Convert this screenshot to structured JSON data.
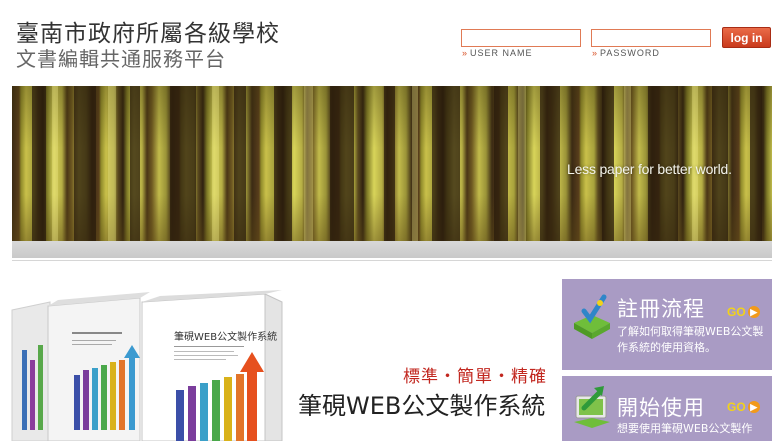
{
  "header": {
    "title": "臺南市政府所屬各級學校",
    "subtitle": "文書編輯共通服務平台"
  },
  "login": {
    "username_value": "",
    "password_value": "",
    "username_label": "USER NAME",
    "password_label": "PASSWORD",
    "login_button": "log in"
  },
  "banner": {
    "tagline": "Less paper for better world."
  },
  "product": {
    "slogan": "標準・簡單・精確",
    "name": "筆硯WEB公文製作系統",
    "box_label": "筆硯WEB公文製作系統"
  },
  "panels": [
    {
      "title": "註冊流程",
      "go_label": "GO",
      "icon": "checkmark-box-icon",
      "description": "了解如何取得筆硯WEB公文製作系統的使用資格。"
    },
    {
      "title": "開始使用",
      "go_label": "GO",
      "icon": "monitor-arrow-icon",
      "description": "想要使用筆硯WEB公文製作"
    }
  ],
  "colors": {
    "accent": "#c2271f",
    "panel": "#a99bc4",
    "go": "#f2d21a",
    "input_border": "#e07a55"
  }
}
